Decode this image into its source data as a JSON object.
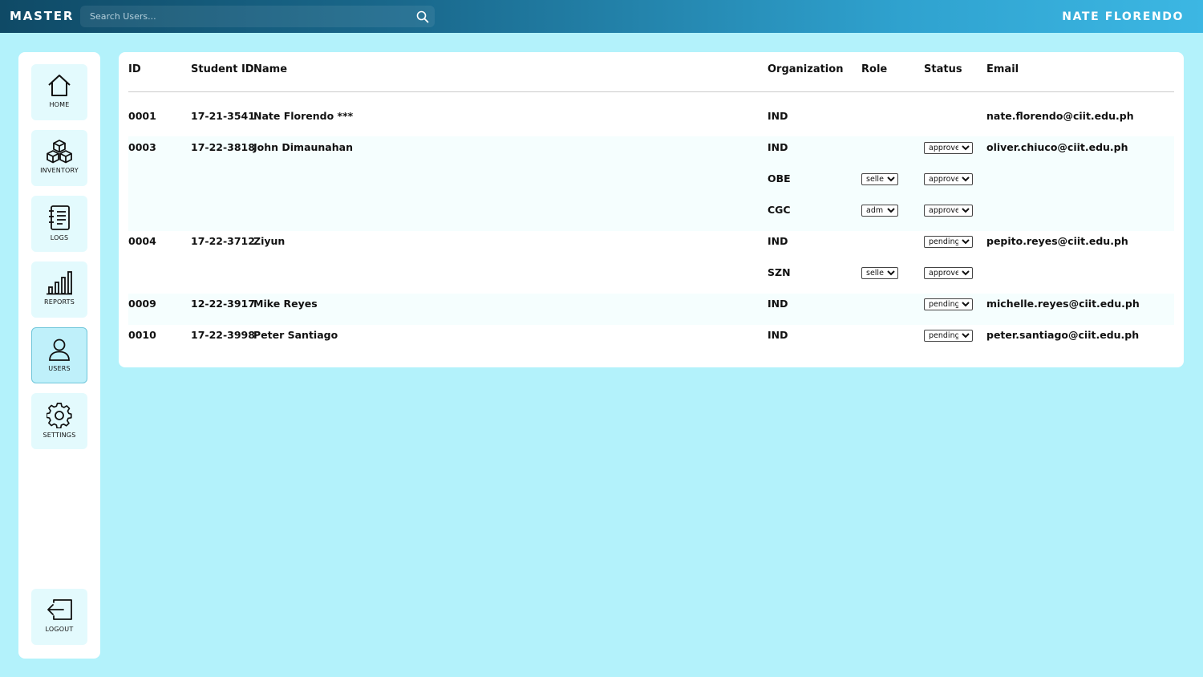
{
  "header": {
    "brand": "MASTER",
    "search_placeholder": "Search Users...",
    "user": "NATE FLORENDO"
  },
  "sidebar": {
    "items": [
      {
        "label": "HOME",
        "icon": "home-icon"
      },
      {
        "label": "INVENTORY",
        "icon": "boxes-icon"
      },
      {
        "label": "LOGS",
        "icon": "notebook-icon"
      },
      {
        "label": "REPORTS",
        "icon": "bar-chart-icon"
      },
      {
        "label": "USERS",
        "icon": "user-icon",
        "active": true
      },
      {
        "label": "SETTINGS",
        "icon": "gear-icon"
      }
    ],
    "logout": {
      "label": "LOGOUT",
      "icon": "logout-icon"
    }
  },
  "table": {
    "headers": {
      "id": "ID",
      "student_id": "Student ID",
      "name": "Name",
      "organization": "Organization",
      "role": "Role",
      "status": "Status",
      "email": "Email"
    },
    "rows": [
      {
        "id": "0001",
        "student_id": "17-21-3541",
        "name": "Nate Florendo ***",
        "org": "IND",
        "role": "",
        "status": "",
        "email": "nate.florendo@ciit.edu.ph"
      },
      {
        "id": "0003",
        "student_id": "17-22-3818",
        "name": "John Dimaunahan",
        "org": "IND",
        "role": "",
        "status": "approved",
        "email": "oliver.chiuco@ciit.edu.ph"
      },
      {
        "id": "",
        "student_id": "",
        "name": "",
        "org": "OBE",
        "role": "seller",
        "status": "approved",
        "email": ""
      },
      {
        "id": "",
        "student_id": "",
        "name": "",
        "org": "CGC",
        "role": "admin",
        "status": "approved",
        "email": ""
      },
      {
        "id": "0004",
        "student_id": "17-22-3712",
        "name": "Ziyun",
        "org": "IND",
        "role": "",
        "status": "pending",
        "email": "pepito.reyes@ciit.edu.ph"
      },
      {
        "id": "",
        "student_id": "",
        "name": "",
        "org": "SZN",
        "role": "seller",
        "status": "approved",
        "email": ""
      },
      {
        "id": "0009",
        "student_id": "12-22-3917",
        "name": "Mike Reyes",
        "org": "IND",
        "role": "",
        "status": "pending",
        "email": "michelle.reyes@ciit.edu.ph"
      },
      {
        "id": "0010",
        "student_id": "17-22-3998",
        "name": "Peter Santiago",
        "org": "IND",
        "role": "",
        "status": "pending",
        "email": "peter.santiago@ciit.edu.ph"
      }
    ]
  },
  "colors": {
    "background": "#b3f2fb",
    "header_start": "#0f4a66",
    "header_end": "#3cb7e3",
    "nav_item_bg": "#e3fafd"
  }
}
